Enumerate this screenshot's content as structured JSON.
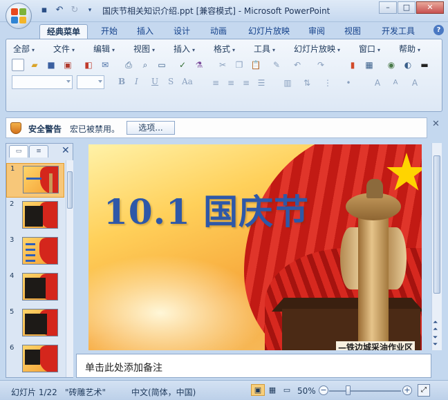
{
  "window": {
    "title": "国庆节相关知识介绍.ppt [兼容模式] - Microsoft PowerPoint",
    "controls": [
      "–",
      "□",
      "✕"
    ]
  },
  "qat": [
    "save-icon",
    "undo-icon",
    "redo-icon"
  ],
  "tabs": [
    {
      "label": "经典菜单",
      "active": true
    },
    {
      "label": "开始"
    },
    {
      "label": "插入"
    },
    {
      "label": "设计"
    },
    {
      "label": "动画"
    },
    {
      "label": "幻灯片放映"
    },
    {
      "label": "审阅"
    },
    {
      "label": "视图"
    },
    {
      "label": "开发工具"
    }
  ],
  "menus": [
    "全部",
    "文件",
    "编辑",
    "视图",
    "插入",
    "格式",
    "工具",
    "幻灯片放映",
    "窗口",
    "帮助"
  ],
  "format_buttons": [
    "B",
    "I",
    "U",
    "S",
    "Aa"
  ],
  "security": {
    "title": "安全警告",
    "message": "宏已被禁用。",
    "button": "选项..."
  },
  "slides": {
    "count": 22,
    "thumbnails": [
      {
        "number": "1"
      },
      {
        "number": "2"
      },
      {
        "number": "3"
      },
      {
        "number": "4"
      },
      {
        "number": "5"
      },
      {
        "number": "6"
      }
    ]
  },
  "current_slide": {
    "title": "10.1 国庆节",
    "caption": "—铁边城采油作业区"
  },
  "notes": {
    "placeholder": "单击此处添加备注"
  },
  "status": {
    "slide_info": "幻灯片 1/22",
    "theme": "\"砖雕艺术\"",
    "language": "中文(简体，中国)",
    "zoom": "50%"
  },
  "colors": {
    "title_blue": "#2e58a8",
    "ribbon_blue": "#c5d8ef",
    "selection_orange": "#f7c779"
  }
}
